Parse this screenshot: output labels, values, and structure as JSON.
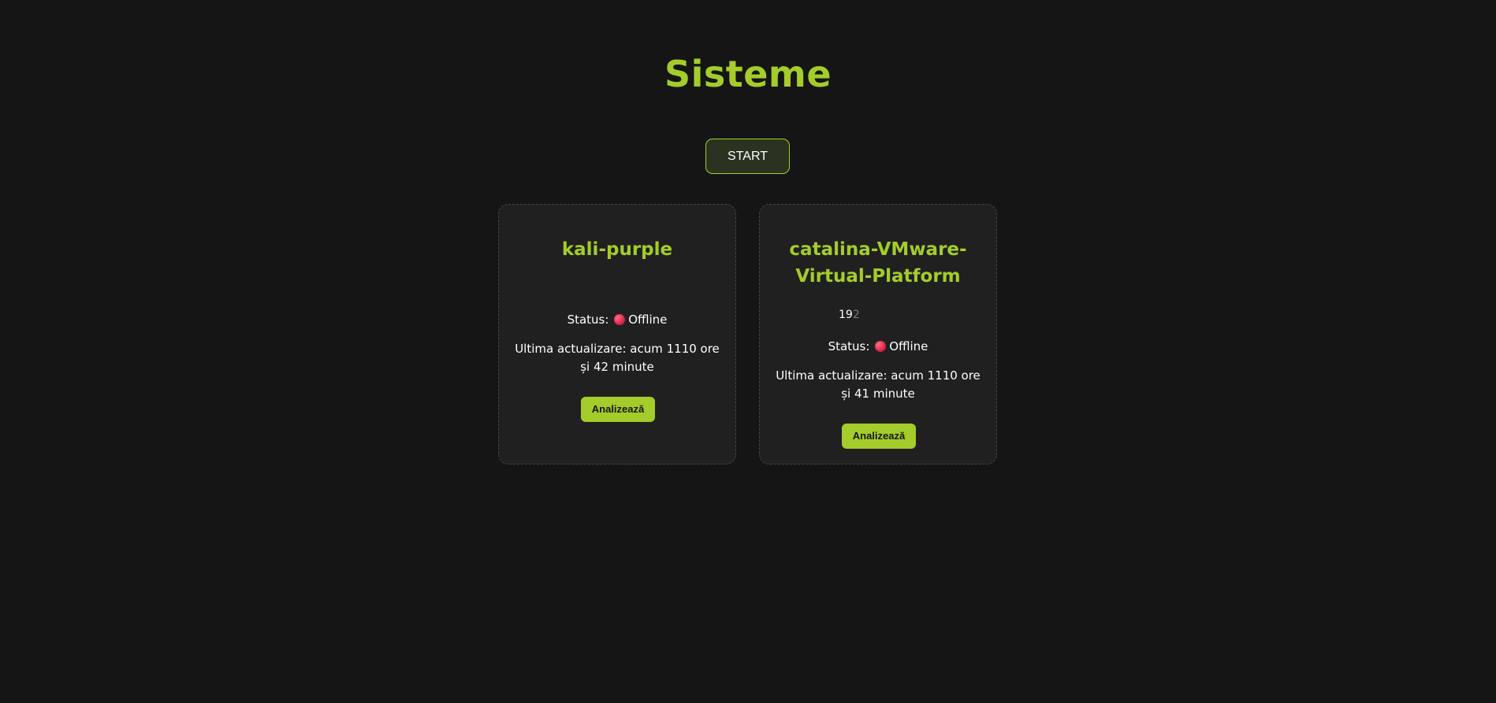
{
  "page": {
    "title": "Sisteme",
    "start_label": "START"
  },
  "colors": {
    "accent": "#a4cc2a",
    "background": "#151515",
    "card_background": "#202020",
    "offline_dot": "#e12a4a"
  },
  "systems": [
    {
      "name": "kali-purple",
      "ip": "",
      "status_label": "Status:",
      "status_icon": "red-circle-icon",
      "status_value": "Offline",
      "last_update": "Ultima actualizare: acum 1110 ore și 42 minute",
      "analyze_label": "Analizează"
    },
    {
      "name": "catalina-VMware-Virtual-Platform",
      "ip_visible": "19",
      "ip_faded": "2",
      "status_label": "Status:",
      "status_icon": "red-circle-icon",
      "status_value": "Offline",
      "last_update": "Ultima actualizare: acum 1110 ore și 41 minute",
      "analyze_label": "Analizează"
    }
  ]
}
